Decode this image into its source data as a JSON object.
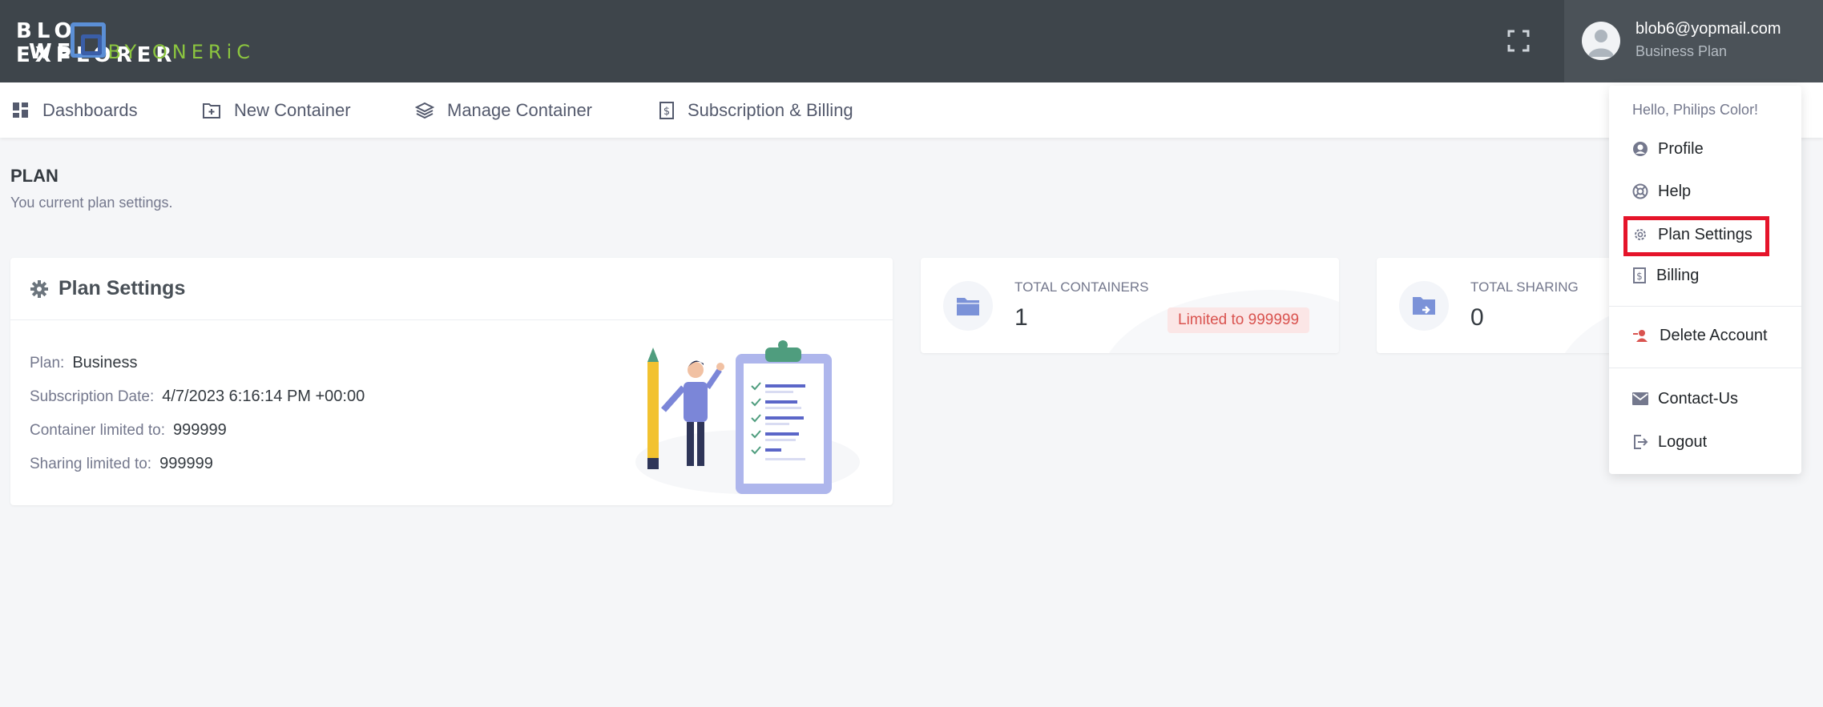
{
  "header": {
    "logo": {
      "row1": [
        "BLO",
        "EXPLORER"
      ],
      "row2": [
        "WE",
        "BY ONERiC"
      ]
    },
    "user": {
      "email": "blob6@yopmail.com",
      "plan": "Business Plan"
    },
    "icons": {
      "fullscreen": "fullscreen-icon",
      "avatar": "user-avatar"
    }
  },
  "nav": {
    "items": [
      {
        "label": "Dashboards",
        "icon": "grid-icon"
      },
      {
        "label": "New Container",
        "icon": "folder-plus-icon"
      },
      {
        "label": "Manage Container",
        "icon": "layers-icon"
      },
      {
        "label": "Subscription & Billing",
        "icon": "dollar-document-icon"
      }
    ]
  },
  "page": {
    "title": "PLAN",
    "subtitle": "You current plan settings."
  },
  "plan_card": {
    "title": "Plan Settings",
    "details": [
      {
        "label": "Plan:",
        "value": "Business"
      },
      {
        "label": "Subscription Date:",
        "value": "4/7/2023 6:16:14 PM +00:00"
      },
      {
        "label": "Container limited to:",
        "value": "999999"
      },
      {
        "label": "Sharing limited to:",
        "value": "999999"
      }
    ]
  },
  "stats": [
    {
      "label": "TOTAL CONTAINERS",
      "value": "1",
      "badge": "Limited to 999999",
      "icon": "folder-icon"
    },
    {
      "label": "TOTAL SHARING",
      "value": "0",
      "icon": "folder-share-icon"
    }
  ],
  "dropdown": {
    "greeting": "Hello, Philips Color!",
    "items": [
      {
        "label": "Profile",
        "icon": "user-circle-icon"
      },
      {
        "label": "Help",
        "icon": "lifebuoy-icon"
      },
      {
        "label": "Plan Settings",
        "icon": "gear-icon",
        "highlighted": true
      },
      {
        "label": "Billing",
        "icon": "dollar-document-icon"
      },
      {
        "label": "Delete Account",
        "icon": "user-remove-icon"
      },
      {
        "label": "Contact-Us",
        "icon": "mail-icon"
      },
      {
        "label": "Logout",
        "icon": "logout-icon"
      }
    ]
  },
  "colors": {
    "header_bg": "#3e454b",
    "accent": "#5b8fd6",
    "danger": "#d9534f",
    "highlight_border": "#e5142a"
  }
}
